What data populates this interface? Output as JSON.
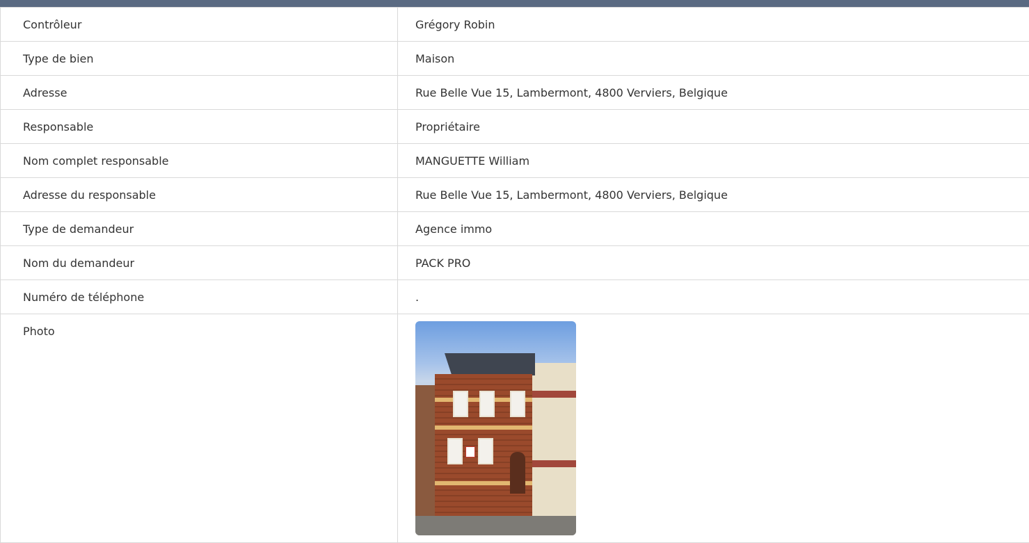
{
  "rows": [
    {
      "label": "Contrôleur",
      "value": "Grégory Robin"
    },
    {
      "label": "Type de bien",
      "value": "Maison"
    },
    {
      "label": "Adresse",
      "value": "Rue Belle Vue 15, Lambermont, 4800 Verviers, Belgique"
    },
    {
      "label": "Responsable",
      "value": "Propriétaire"
    },
    {
      "label": "Nom complet responsable",
      "value": "MANGUETTE William"
    },
    {
      "label": "Adresse du responsable",
      "value": "Rue Belle Vue 15, Lambermont, 4800 Verviers, Belgique"
    },
    {
      "label": "Type de demandeur",
      "value": "Agence immo"
    },
    {
      "label": "Nom du demandeur",
      "value": "PACK PRO"
    },
    {
      "label": "Numéro de téléphone",
      "value": "."
    }
  ],
  "photo_row": {
    "label": "Photo"
  }
}
